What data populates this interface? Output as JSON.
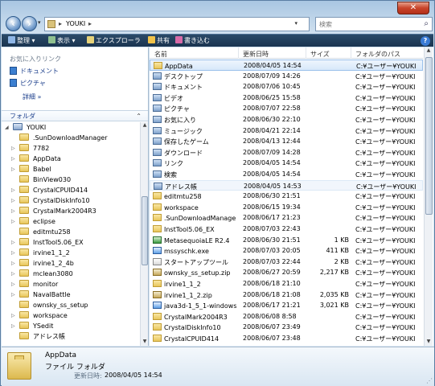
{
  "window": {
    "close_label": "✕"
  },
  "address": {
    "path": "YOUKI",
    "separator": "▸"
  },
  "search": {
    "placeholder": "検索"
  },
  "toolbar": [
    {
      "id": "organize",
      "label": "整理 ▾",
      "color": "#8fb6e6"
    },
    {
      "id": "view",
      "label": "表示 ▾",
      "color": "#8fc08f"
    },
    {
      "id": "explore",
      "label": "エクスプローラ",
      "color": "#e6d27a"
    },
    {
      "id": "share",
      "label": "共有",
      "color": "#f0c24a"
    },
    {
      "id": "burn",
      "label": "書き込む",
      "color": "#d86aa8"
    }
  ],
  "favorites": {
    "header": "お気に入りリンク",
    "items": [
      {
        "label": "ドキュメント"
      },
      {
        "label": "ピクチャ"
      }
    ],
    "more": "詳細 »"
  },
  "folders": {
    "header": "フォルダ",
    "items": [
      {
        "label": "YOUKI",
        "depth": 0,
        "exp": "◢",
        "type": "user"
      },
      {
        "label": ".SunDownloadManager",
        "depth": 1,
        "exp": "",
        "type": "folder"
      },
      {
        "label": "7782",
        "depth": 1,
        "exp": "▷",
        "type": "folder"
      },
      {
        "label": "AppData",
        "depth": 1,
        "exp": "▷",
        "type": "folder"
      },
      {
        "label": "Babel",
        "depth": 1,
        "exp": "▷",
        "type": "folder"
      },
      {
        "label": "BinView030",
        "depth": 1,
        "exp": "",
        "type": "folder"
      },
      {
        "label": "CrystalCPUID414",
        "depth": 1,
        "exp": "▷",
        "type": "folder"
      },
      {
        "label": "CrystalDiskInfo10",
        "depth": 1,
        "exp": "▷",
        "type": "folder"
      },
      {
        "label": "CrystalMark2004R3",
        "depth": 1,
        "exp": "▷",
        "type": "folder"
      },
      {
        "label": "eclipse",
        "depth": 1,
        "exp": "▷",
        "type": "folder"
      },
      {
        "label": "editmtu258",
        "depth": 1,
        "exp": "",
        "type": "folder"
      },
      {
        "label": "InstTool5.06_EX",
        "depth": 1,
        "exp": "▷",
        "type": "folder"
      },
      {
        "label": "irvine1_1_2",
        "depth": 1,
        "exp": "▷",
        "type": "folder"
      },
      {
        "label": "irvine1_2_4b",
        "depth": 1,
        "exp": "▷",
        "type": "folder"
      },
      {
        "label": "mclean3080",
        "depth": 1,
        "exp": "▷",
        "type": "folder"
      },
      {
        "label": "monitor",
        "depth": 1,
        "exp": "▷",
        "type": "folder"
      },
      {
        "label": "NavalBattle",
        "depth": 1,
        "exp": "▷",
        "type": "folder"
      },
      {
        "label": "ownsky_ss_setup",
        "depth": 1,
        "exp": "",
        "type": "folder"
      },
      {
        "label": "workspace",
        "depth": 1,
        "exp": "▷",
        "type": "folder"
      },
      {
        "label": "YSedit",
        "depth": 1,
        "exp": "▷",
        "type": "folder"
      },
      {
        "label": "アドレス帳",
        "depth": 1,
        "exp": "",
        "type": "special"
      }
    ]
  },
  "columns": {
    "name": "名前",
    "modified": "更新日時",
    "size": "サイズ",
    "folder": "フォルダのパス"
  },
  "files": [
    {
      "name": "AppData",
      "modified": "2008/04/05 14:54",
      "size": "",
      "folder": "C:¥ユーザー¥YOUKI",
      "icon": "folder",
      "state": "selected"
    },
    {
      "name": "デスクトップ",
      "modified": "2008/07/09 14:26",
      "size": "",
      "folder": "C:¥ユーザー¥YOUKI",
      "icon": "special",
      "state": ""
    },
    {
      "name": "ドキュメント",
      "modified": "2008/07/06 10:45",
      "size": "",
      "folder": "C:¥ユーザー¥YOUKI",
      "icon": "special",
      "state": ""
    },
    {
      "name": "ビデオ",
      "modified": "2008/06/25 15:58",
      "size": "",
      "folder": "C:¥ユーザー¥YOUKI",
      "icon": "special",
      "state": ""
    },
    {
      "name": "ピクチャ",
      "modified": "2008/07/07 22:58",
      "size": "",
      "folder": "C:¥ユーザー¥YOUKI",
      "icon": "special",
      "state": ""
    },
    {
      "name": "お気に入り",
      "modified": "2008/06/30 22:10",
      "size": "",
      "folder": "C:¥ユーザー¥YOUKI",
      "icon": "special",
      "state": ""
    },
    {
      "name": "ミュージック",
      "modified": "2008/04/21 22:14",
      "size": "",
      "folder": "C:¥ユーザー¥YOUKI",
      "icon": "special",
      "state": ""
    },
    {
      "name": "保存したゲーム",
      "modified": "2008/04/13 12:44",
      "size": "",
      "folder": "C:¥ユーザー¥YOUKI",
      "icon": "special",
      "state": ""
    },
    {
      "name": "ダウンロード",
      "modified": "2008/07/09 14:28",
      "size": "",
      "folder": "C:¥ユーザー¥YOUKI",
      "icon": "special",
      "state": ""
    },
    {
      "name": "リンク",
      "modified": "2008/04/05 14:54",
      "size": "",
      "folder": "C:¥ユーザー¥YOUKI",
      "icon": "special",
      "state": ""
    },
    {
      "name": "検索",
      "modified": "2008/04/05 14:54",
      "size": "",
      "folder": "C:¥ユーザー¥YOUKI",
      "icon": "special",
      "state": ""
    },
    {
      "name": "アドレス帳",
      "modified": "2008/04/05 14:53",
      "size": "",
      "folder": "C:¥ユーザー¥YOUKI",
      "icon": "special",
      "state": "hover"
    },
    {
      "name": "editmtu258",
      "modified": "2008/06/30 21:51",
      "size": "",
      "folder": "C:¥ユーザー¥YOUKI",
      "icon": "folder",
      "state": ""
    },
    {
      "name": "workspace",
      "modified": "2008/06/15 19:34",
      "size": "",
      "folder": "C:¥ユーザー¥YOUKI",
      "icon": "folder",
      "state": ""
    },
    {
      "name": ".SunDownloadManager",
      "modified": "2008/06/17 21:23",
      "size": "",
      "folder": "C:¥ユーザー¥YOUKI",
      "icon": "folder",
      "state": ""
    },
    {
      "name": "InstTool5.06_EX",
      "modified": "2008/07/03 22:43",
      "size": "",
      "folder": "C:¥ユーザー¥YOUKI",
      "icon": "folder",
      "state": ""
    },
    {
      "name": "MetasequoiaLE R2.4",
      "modified": "2008/06/30 21:51",
      "size": "1 KB",
      "folder": "C:¥ユーザー¥YOUKI",
      "icon": "app",
      "state": ""
    },
    {
      "name": "mssyschk.exe",
      "modified": "2008/07/03 20:05",
      "size": "411 KB",
      "folder": "C:¥ユーザー¥YOUKI",
      "icon": "exe",
      "state": ""
    },
    {
      "name": "スタートアップツール",
      "modified": "2008/07/03 22:44",
      "size": "2 KB",
      "folder": "C:¥ユーザー¥YOUKI",
      "icon": "lnk",
      "state": ""
    },
    {
      "name": "ownsky_ss_setup.zip",
      "modified": "2008/06/27 20:59",
      "size": "2,217 KB",
      "folder": "C:¥ユーザー¥YOUKI",
      "icon": "zip",
      "state": ""
    },
    {
      "name": "irvine1_1_2",
      "modified": "2008/06/18 21:10",
      "size": "",
      "folder": "C:¥ユーザー¥YOUKI",
      "icon": "folder",
      "state": ""
    },
    {
      "name": "irvine1_1_2.zip",
      "modified": "2008/06/18 21:08",
      "size": "2,035 KB",
      "folder": "C:¥ユーザー¥YOUKI",
      "icon": "zip",
      "state": ""
    },
    {
      "name": "java3d-1_5_1-windows...",
      "modified": "2008/06/17 21:21",
      "size": "3,021 KB",
      "folder": "C:¥ユーザー¥YOUKI",
      "icon": "exe",
      "state": ""
    },
    {
      "name": "CrystalMark2004R3",
      "modified": "2008/06/08 8:58",
      "size": "",
      "folder": "C:¥ユーザー¥YOUKI",
      "icon": "folder",
      "state": ""
    },
    {
      "name": "CrystalDiskInfo10",
      "modified": "2008/06/07 23:49",
      "size": "",
      "folder": "C:¥ユーザー¥YOUKI",
      "icon": "folder",
      "state": ""
    },
    {
      "name": "CrystalCPUID414",
      "modified": "2008/06/07 23:48",
      "size": "",
      "folder": "C:¥ユーザー¥YOUKI",
      "icon": "folder",
      "state": ""
    }
  ],
  "details": {
    "name": "AppData",
    "type": "ファイル フォルダ",
    "modified_label": "更新日時:",
    "modified_value": "2008/04/05 14:54"
  }
}
